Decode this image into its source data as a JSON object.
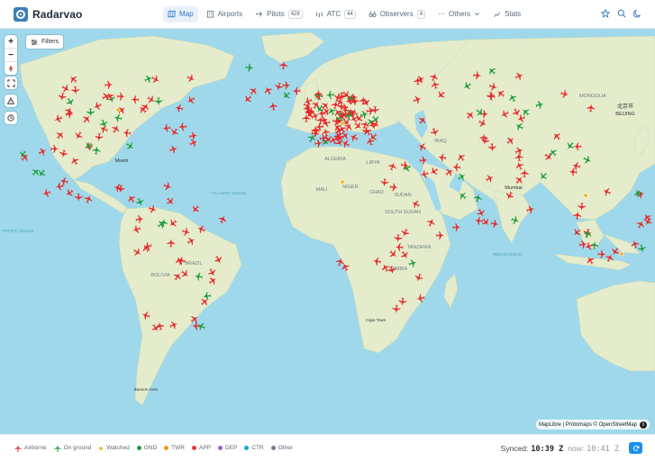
{
  "app": {
    "title": "Radarvao"
  },
  "nav": {
    "map": "Map",
    "airports": "Airports",
    "pilots": "Pilots",
    "pilots_count": "428",
    "atc": "ATC",
    "atc_count": "44",
    "observers": "Observers",
    "observers_count": "4",
    "others": "Others",
    "stats": "Stats"
  },
  "map": {
    "filters_label": "Filters",
    "attribution": "MapLibre | Protomaps © OpenStreetMap",
    "labels": [
      {
        "text": "MONGOLIA",
        "cls": "c"
      },
      {
        "text": "北京市",
        "cls": "city"
      },
      {
        "text": "BEIJING",
        "cls": "city"
      },
      {
        "text": "ALGERIA",
        "cls": "c"
      },
      {
        "text": "LIBYA",
        "cls": "c"
      },
      {
        "text": "IRAQ",
        "cls": "c"
      },
      {
        "text": "Mumbai",
        "cls": "city"
      },
      {
        "text": "Miami",
        "cls": "city"
      },
      {
        "text": "ATLANTIC OCEAN",
        "cls": "o"
      },
      {
        "text": "PACIFIC OCEAN",
        "cls": "o"
      },
      {
        "text": "INDIAN OCEAN",
        "cls": "o"
      },
      {
        "text": "MALI",
        "cls": "c"
      },
      {
        "text": "NIGER",
        "cls": "c"
      },
      {
        "text": "CHAD",
        "cls": "c"
      },
      {
        "text": "SUDAN",
        "cls": "c"
      },
      {
        "text": "SOUTH SUDAN",
        "cls": "c"
      },
      {
        "text": "TANZANIA",
        "cls": "c"
      },
      {
        "text": "ZAMBIA",
        "cls": "c"
      },
      {
        "text": "BOLIVIA",
        "cls": "c"
      },
      {
        "text": "BRAZIL",
        "cls": "c"
      },
      {
        "text": "Cape Town",
        "cls": "city"
      },
      {
        "text": "Buenos Aires",
        "cls": "city"
      }
    ]
  },
  "legend": {
    "airborne": "Airborne",
    "on_ground": "On ground",
    "watched": "Watched",
    "gnd": "GND",
    "twr": "TWR",
    "app": "APP",
    "dep": "DEP",
    "ctr": "CTR",
    "other": "Other"
  },
  "colors": {
    "airborne": "#e62a2a",
    "on_ground": "#1f9d3a",
    "watched": "#f0b323",
    "gnd": "#1f9d3a",
    "twr": "#f29a1e",
    "app": "#e03b3b",
    "dep": "#9b59d0",
    "ctr": "#1aa3d8",
    "other": "#6b7f99",
    "land": "#e4eccc",
    "water": "#9fd8eb"
  },
  "status": {
    "synced_label": "Synced:",
    "synced_time": "10:39 Z",
    "now_label": "now:",
    "now_time": "10:41 Z"
  }
}
